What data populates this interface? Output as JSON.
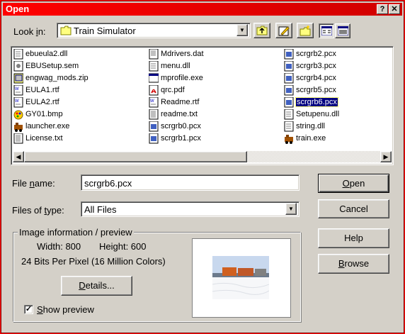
{
  "window": {
    "title": "Open",
    "help_btn": "?",
    "close_btn": "✕"
  },
  "lookin": {
    "label_pre": "Look ",
    "label_key": "i",
    "label_post": "n:",
    "value": "Train Simulator"
  },
  "files": {
    "col1": [
      "ebueula2.dll",
      "EBUSetup.sem",
      "engwag_mods.zip",
      "EULA1.rtf",
      "EULA2.rtf",
      "GY01.bmp",
      "launcher.exe",
      "License.txt"
    ],
    "col2": [
      "Mdrivers.dat",
      "menu.dll",
      "mprofile.exe",
      "qrc.pdf",
      "Readme.rtf",
      "readme.txt",
      "scrgrb0.pcx",
      "scrgrb1.pcx"
    ],
    "col3": [
      "scrgrb2.pcx",
      "scrgrb3.pcx",
      "scrgrb4.pcx",
      "scrgrb5.pcx",
      "scrgrb6.pcx",
      "Setupenu.dll",
      "string.dll",
      "train.exe"
    ]
  },
  "filename": {
    "label_pre": "File ",
    "label_key": "n",
    "label_post": "ame:",
    "value": "scrgrb6.pcx"
  },
  "filetype": {
    "label_pre": "Files of ",
    "label_key": "t",
    "label_post": "ype:",
    "value": "All Files"
  },
  "buttons": {
    "open_key": "O",
    "open_rest": "pen",
    "cancel": "Cancel",
    "help": "Help",
    "browse_key": "B",
    "browse_rest": "rowse",
    "details_key": "D",
    "details_rest": "etails..."
  },
  "preview": {
    "group_label": "Image information / preview",
    "width": "Width: 800",
    "height": "Height: 600",
    "bits": "24 Bits Per Pixel (16 Million Colors)",
    "show_key": "S",
    "show_rest": "how preview",
    "show_checked": "✓"
  }
}
